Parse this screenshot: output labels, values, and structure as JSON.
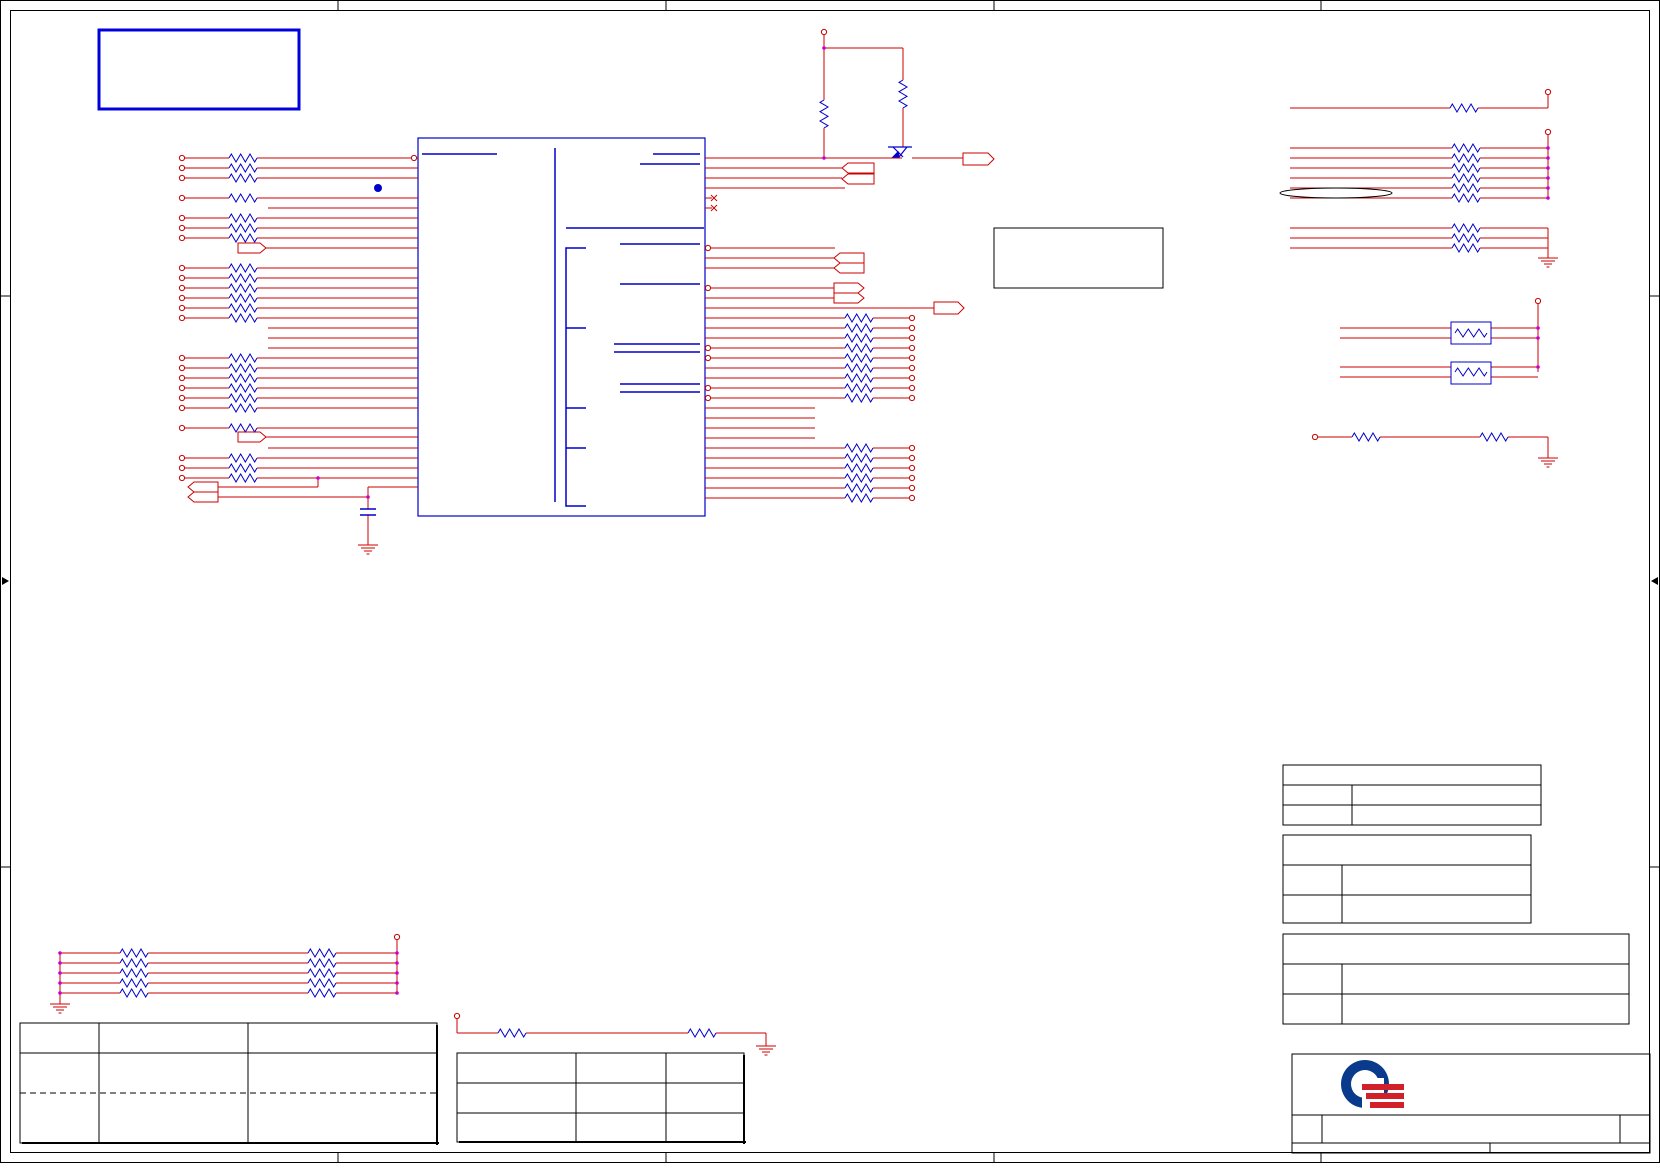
{
  "diagram": {
    "type": "schematic",
    "colors": {
      "frame": "#000000",
      "wire": "#cc0000",
      "component": "#0000cc",
      "junction": "#cc00cc",
      "note_box": "#0000dd",
      "logo_blue": "#0a3a8c",
      "logo_red": "#d2202a"
    },
    "text": {},
    "components": {
      "main_ic": "ic-block",
      "transistor": "npn-transistor",
      "ground": "ground-symbol",
      "capacitor": "capacitor",
      "resistor": "resistor",
      "resistor_array": "resistor-network",
      "net_port": "off-page-connector",
      "test_point": "test-point"
    },
    "logo": {
      "name": "company-logo"
    }
  }
}
